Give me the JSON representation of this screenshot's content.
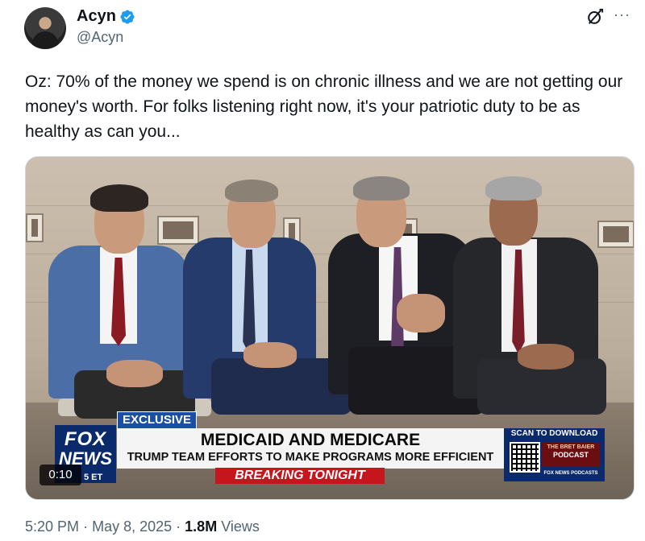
{
  "author": {
    "name": "Acyn",
    "handle": "@Acyn",
    "verified_color": "#1d9bf0"
  },
  "tweet": {
    "text": "Oz: 70% of the money we spend is on chronic illness and we are not getting our money's worth. For folks listening right now, it's your patriotic duty to be as healthy as can you..."
  },
  "icons": {
    "grok": "grok-icon",
    "more": "more-icon",
    "verified": "verified-badge-icon"
  },
  "video": {
    "duration": "0:10",
    "fox_top": "FOX",
    "fox_bottom": "NEWS",
    "fox_time": "5 ET",
    "exclusive": "EXCLUSIVE",
    "headline": "MEDICAID AND MEDICARE",
    "subheadline": "TRUMP TEAM EFFORTS TO MAKE PROGRAMS MORE EFFICIENT",
    "breaking": "BREAKING TONIGHT",
    "scan_label": "SCAN TO DOWNLOAD",
    "podcast_name": "THE BRET BAIER",
    "podcast_word": "PODCAST",
    "podcast_sub": "FOX NEWS PODCASTS",
    "colors": {
      "fox_blue": "#0a2a6b",
      "breaking_red": "#c4161c",
      "exclusive_blue": "#1a4fa3"
    }
  },
  "meta": {
    "time": "5:20 PM",
    "date": "May 8, 2025",
    "separator": "·",
    "views_count": "1.8M",
    "views_label": "Views"
  }
}
